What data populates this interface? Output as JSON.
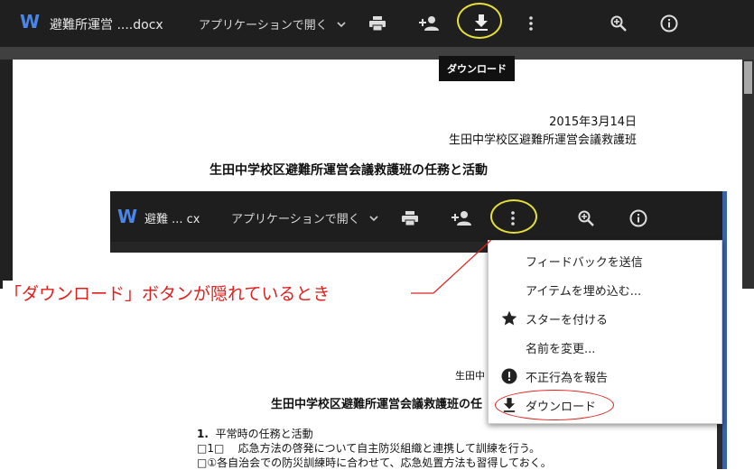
{
  "outer": {
    "file_title": "避難所運営 ....docx",
    "open_with": "アプリケーションで開く",
    "tooltip": "ダウンロード",
    "doc": {
      "date": "2015年3月14日",
      "org": "生田中学校区避難所運営会議救護班",
      "title": "生田中学校区避難所運営会議救護班の任務と活動"
    }
  },
  "inner": {
    "file_title": "避難 ... cx",
    "open_with": "アプリケーションで開く",
    "doc": {
      "org_partial": "生田中",
      "title_partial": "生田中学校区避難所運営会議救護班の任",
      "section_num": "1.",
      "section_title": "平常時の任務と活動",
      "line1_prefix": "□1□",
      "line1": "応急方法の啓発について自主防災組織と連携して訓練を行う。",
      "line2": "□①各自治会での防災訓練時に合わせて、応急処置方法も習得しておく。"
    },
    "menu": [
      {
        "label": "フィードバックを送信",
        "icon": ""
      },
      {
        "label": "アイテムを埋め込む...",
        "icon": ""
      },
      {
        "label": "スターを付ける",
        "icon": "star-icon"
      },
      {
        "label": "名前を変更...",
        "icon": ""
      },
      {
        "label": "不正行為を報告",
        "icon": "report-icon"
      },
      {
        "label": "ダウンロード",
        "icon": "download-icon"
      }
    ]
  },
  "annotation": "「ダウンロード」ボタンが隠れているとき",
  "colors": {
    "highlight_yellow": "#e5e03a",
    "annotation_red": "#e0201e",
    "word_blue": "#4a86e8"
  }
}
